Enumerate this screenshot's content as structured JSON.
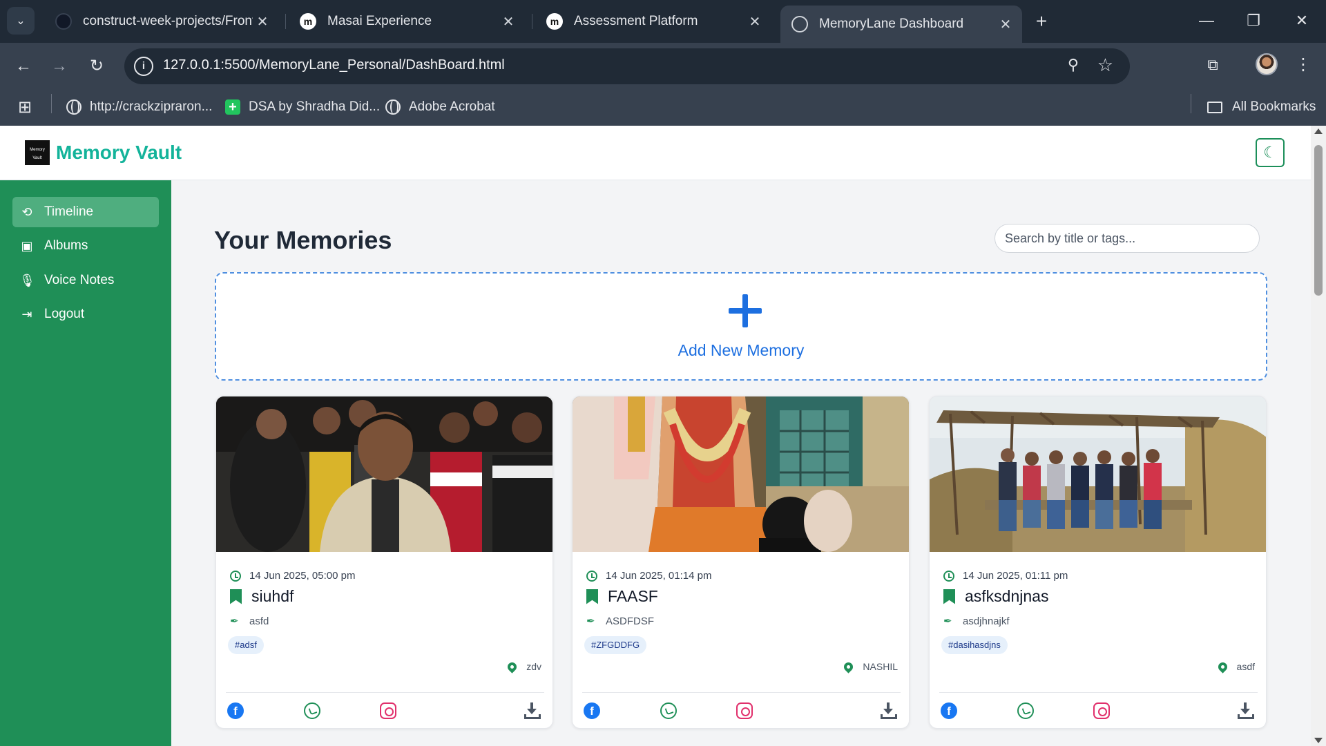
{
  "browser": {
    "tabs": [
      {
        "title": "construct-week-projects/FrontE",
        "icon": "github-icon"
      },
      {
        "title": "Masai Experience",
        "icon": "masai-icon"
      },
      {
        "title": "Assessment Platform",
        "icon": "masai-icon"
      },
      {
        "title": "MemoryLane Dashboard",
        "icon": "globe-icon",
        "active": true
      }
    ],
    "url": "127.0.0.1:5500/MemoryLane_Personal/DashBoard.html",
    "bookmarks": [
      {
        "label": "http://crackzipraron...",
        "icon": "globe-icon"
      },
      {
        "label": "DSA by Shradha Did...",
        "icon": "plus-square-icon"
      },
      {
        "label": "Adobe Acrobat",
        "icon": "globe-icon"
      }
    ],
    "all_bookmarks": "All Bookmarks"
  },
  "app": {
    "logo_text": "Memory Vault",
    "brand": "Memory Vault",
    "accent": "#1f8f57",
    "brand_color": "#13b39a",
    "link_color": "#1d6fe0"
  },
  "sidebar": {
    "items": [
      {
        "label": "Timeline",
        "icon": "history-icon",
        "active": true
      },
      {
        "label": "Albums",
        "icon": "images-icon"
      },
      {
        "label": "Voice Notes",
        "icon": "microphone-icon"
      },
      {
        "label": "Logout",
        "icon": "logout-icon"
      }
    ]
  },
  "main": {
    "title": "Your Memories",
    "search_placeholder": "Search by title or tags...",
    "add_label": "Add New Memory"
  },
  "memories": [
    {
      "date": "14 Jun 2025, 05:00 pm",
      "title": "siuhdf",
      "description": "asfd",
      "tag": "#adsf",
      "location": "zdv"
    },
    {
      "date": "14 Jun 2025, 01:14 pm",
      "title": "FAASF",
      "description": "ASDFDSF",
      "tag": "#ZFGDDFG",
      "location": "NASHIL"
    },
    {
      "date": "14 Jun 2025, 01:11 pm",
      "title": "asfksdnjnas",
      "description": "asdjhnajkf",
      "tag": "#dasihasdjns",
      "location": "asdf"
    }
  ]
}
